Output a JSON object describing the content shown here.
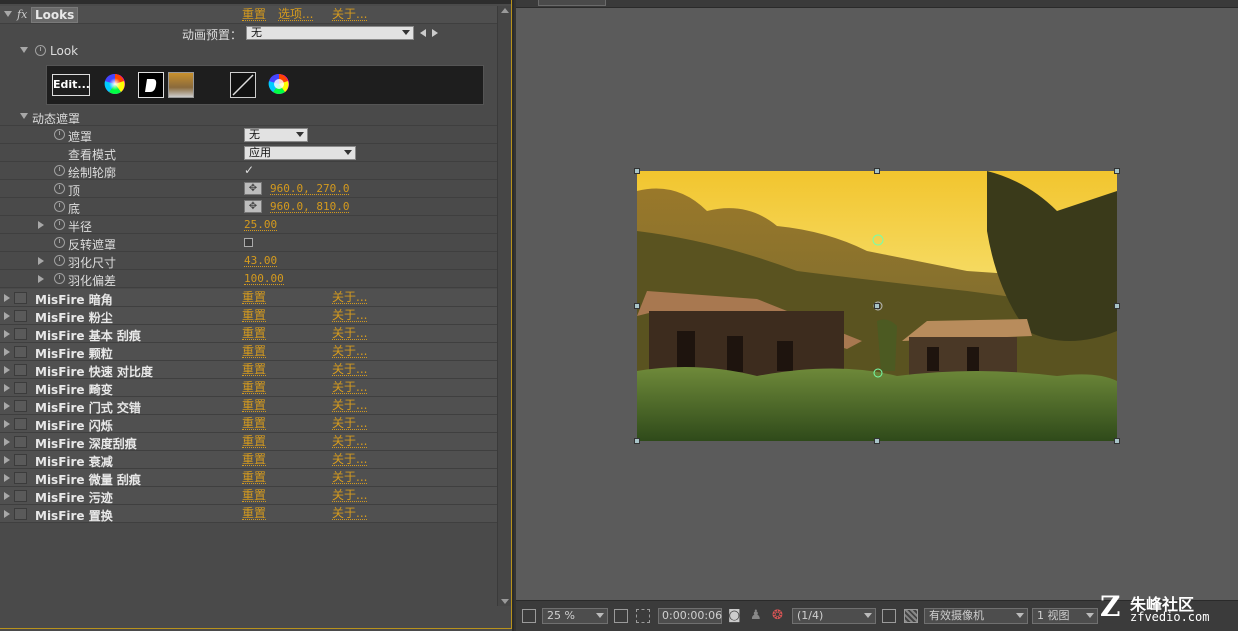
{
  "effect": {
    "name": "Looks",
    "reset": "重置",
    "options": "选项...",
    "about": "关于..."
  },
  "animation_preset": {
    "label": "动画预置：",
    "value": "无"
  },
  "look": {
    "label": "Look",
    "edit_button": "Edit..."
  },
  "dynamic_mask": {
    "label": "动态遮罩",
    "props": {
      "mask": {
        "label": "遮罩",
        "value": "无"
      },
      "view_mode": {
        "label": "查看模式",
        "value": "应用"
      },
      "draw_outline": {
        "label": "绘制轮廓",
        "checked": true
      },
      "top": {
        "label": "顶",
        "value": "960.0, 270.0"
      },
      "bottom": {
        "label": "底",
        "value": "960.0, 810.0"
      },
      "radius": {
        "label": "半径",
        "value": "25.00"
      },
      "invert": {
        "label": "反转遮罩",
        "checked": false
      },
      "feather_size": {
        "label": "羽化尺寸",
        "value": "43.00"
      },
      "feather_bias": {
        "label": "羽化偏差",
        "value": "100.00"
      }
    }
  },
  "misfire": [
    {
      "name": "MisFire 暗角"
    },
    {
      "name": "MisFire 粉尘"
    },
    {
      "name": "MisFire 基本 刮痕"
    },
    {
      "name": "MisFire 颗粒"
    },
    {
      "name": "MisFire 快速 对比度"
    },
    {
      "name": "MisFire 畸变"
    },
    {
      "name": "MisFire 门式 交错"
    },
    {
      "name": "MisFire 闪烁"
    },
    {
      "name": "MisFire 深度刮痕"
    },
    {
      "name": "MisFire 衰减"
    },
    {
      "name": "MisFire 微量 刮痕"
    },
    {
      "name": "MisFire 污迹"
    },
    {
      "name": "MisFire 置换"
    }
  ],
  "misfire_labels": {
    "reset": "重置",
    "about": "关于..."
  },
  "viewer": {
    "zoom": "25 %",
    "timecode": "0:00:00:06",
    "resolution": "(1/4)",
    "camera": "有效摄像机",
    "views": "1 视图"
  },
  "watermark": {
    "brand": "朱峰社区",
    "url": "zfvedio.com"
  },
  "colors": {
    "accent": "#d49a1e",
    "panel_border": "#b8921c"
  }
}
